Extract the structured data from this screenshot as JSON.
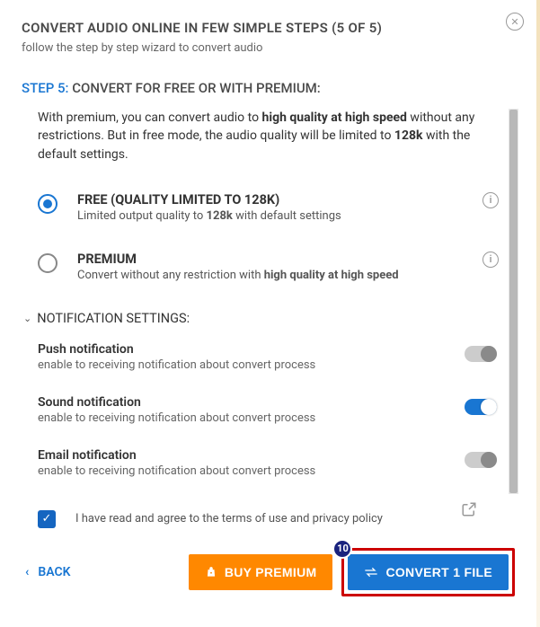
{
  "header": {
    "title": "CONVERT AUDIO ONLINE IN FEW SIMPLE STEPS (5 OF 5)",
    "subtitle": "follow the step by step wizard to convert audio"
  },
  "step": {
    "num_label": "STEP 5:",
    "title": " CONVERT FOR FREE OR WITH PREMIUM:",
    "desc_pre": "With premium, you can convert audio to ",
    "desc_bold1": "high quality at high speed",
    "desc_mid": " without any restrictions. But in free mode, the audio quality will be limited to ",
    "desc_bold2": "128k",
    "desc_post": " with the default settings."
  },
  "plans": {
    "free": {
      "title": "FREE (QUALITY LIMITED TO 128K)",
      "desc_pre": "Limited output quality to ",
      "desc_bold": "128k",
      "desc_post": " with default settings"
    },
    "premium": {
      "title": "PREMIUM",
      "desc_pre": "Convert without any restriction with ",
      "desc_bold": "high quality at high speed",
      "desc_post": ""
    }
  },
  "notif": {
    "heading": "NOTIFICATION SETTINGS:",
    "items": [
      {
        "title": "Push notification",
        "desc": "enable to receiving notification about convert process",
        "on": false
      },
      {
        "title": "Sound notification",
        "desc": "enable to receiving notification about convert process",
        "on": true
      },
      {
        "title": "Email notification",
        "desc": "enable to receiving notification about convert process",
        "on": false
      }
    ]
  },
  "terms": {
    "label": "I have read and agree to the terms of use and privacy policy"
  },
  "footer": {
    "back": "BACK",
    "buy_premium": "BUY PREMIUM",
    "convert": "CONVERT 1 FILE",
    "badge": "10"
  }
}
